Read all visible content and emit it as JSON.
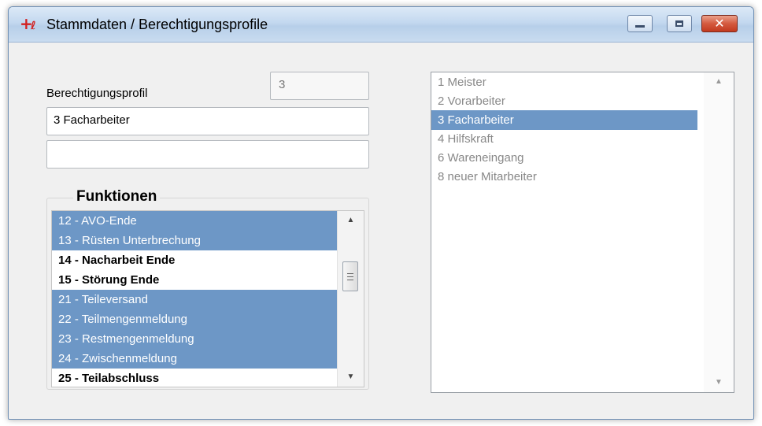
{
  "window": {
    "title": "Stammdaten / Berechtigungsprofile",
    "icon": "app-logo-icon",
    "controls": {
      "minimize": "minimize-icon",
      "maximize": "maximize-icon",
      "close": "close-icon"
    }
  },
  "form": {
    "profile_label": "Berechtigungsprofil",
    "profile_id": "3",
    "profile_name": "3 Facharbeiter",
    "profile_description": ""
  },
  "functions": {
    "group_label": "Funktionen",
    "items": [
      {
        "label": "12 - AVO-Ende",
        "selected": true
      },
      {
        "label": "13 - Rüsten Unterbrechung",
        "selected": true
      },
      {
        "label": "14 - Nacharbeit Ende",
        "selected": false
      },
      {
        "label": "15 - Störung Ende",
        "selected": false
      },
      {
        "label": "21 - Teileversand",
        "selected": true
      },
      {
        "label": "22 - Teilmengenmeldung",
        "selected": true
      },
      {
        "label": "23 - Restmengenmeldung",
        "selected": true
      },
      {
        "label": "24 - Zwischenmeldung",
        "selected": true
      },
      {
        "label": "25 - Teilabschluss",
        "selected": false
      }
    ]
  },
  "profiles": {
    "items": [
      {
        "label": "1 Meister",
        "selected": false
      },
      {
        "label": "2 Vorarbeiter",
        "selected": false
      },
      {
        "label": "3 Facharbeiter",
        "selected": true
      },
      {
        "label": "4 Hilfskraft",
        "selected": false
      },
      {
        "label": "6 Wareneingang",
        "selected": false
      },
      {
        "label": "8 neuer Mitarbeiter",
        "selected": false
      }
    ]
  },
  "colors": {
    "selection": "#6d97c6",
    "window_bg": "#f0f0f0",
    "close_button": "#c23a1f"
  }
}
